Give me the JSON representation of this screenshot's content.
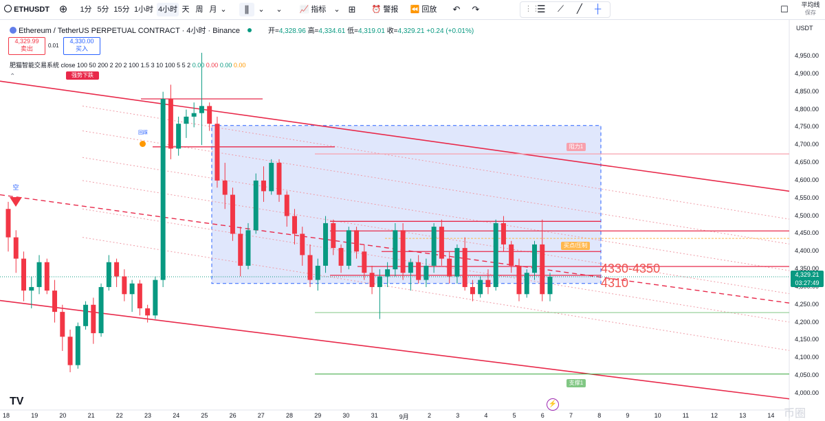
{
  "toolbar": {
    "symbol": "ETHUSDT",
    "intervals": [
      "1分",
      "5分",
      "15分",
      "1小时",
      "4小时",
      "天",
      "周",
      "月"
    ],
    "selected_interval": "4小时",
    "indicators_label": "指标",
    "alert_label": "警报",
    "replay_label": "回放",
    "right_label": "平均线",
    "right_sub": "保存"
  },
  "legend": {
    "title": "Ethereum / TetherUS PERPETUAL CONTRACT · 4小时 · Binance",
    "open_label": "开=",
    "open": "4,328.96",
    "high_label": "高=",
    "high": "4,334.61",
    "low_label": "低=",
    "low": "4,319.01",
    "close_label": "收=",
    "close": "4,329.21",
    "change": "+0.24 (+0.01%)"
  },
  "order": {
    "sell_price": "4,329.99",
    "sell_label": "卖出",
    "spread": "0.01",
    "buy_price": "4,330.00",
    "buy_label": "买入"
  },
  "indicator": {
    "name": "肥猫智能交易系统",
    "params": "close 100 50 200 2 20 2 100 1.5 3 10 100 5 5 2",
    "v1": "0.00",
    "v2": "0.00",
    "v3": "0.00",
    "v4": "0.00"
  },
  "currency": "USDT",
  "price_axis": [
    "4,950.00",
    "4,900.00",
    "4,850.00",
    "4,800.00",
    "4,750.00",
    "4,700.00",
    "4,650.00",
    "4,600.00",
    "4,550.00",
    "4,500.00",
    "4,450.00",
    "4,400.00",
    "4,350.00",
    "4,300.00",
    "4,250.00",
    "4,200.00",
    "4,150.00",
    "4,100.00",
    "4,050.00",
    "4,000.00"
  ],
  "time_axis": [
    "18",
    "19",
    "20",
    "21",
    "22",
    "23",
    "24",
    "25",
    "26",
    "27",
    "28",
    "29",
    "30",
    "31",
    "9月",
    "2",
    "3",
    "4",
    "5",
    "6",
    "7",
    "8",
    "9",
    "10",
    "11",
    "12",
    "13",
    "14"
  ],
  "current_price": {
    "price": "4,329.21",
    "countdown": "03:27:49"
  },
  "annotations": {
    "zone_label": "4330-4350",
    "support_label": "4310",
    "downtrend_tag": "强势下跌",
    "resistance_tag": "阻力1",
    "buy_tag": "买点/压制",
    "support_tag": "支撑1",
    "short_tag": "空",
    "return_tag": "回踩"
  },
  "watermark": "币圈",
  "colors": {
    "up": "#089981",
    "down": "#f23645",
    "channel": "#e8294a",
    "zone": "#c5d3f7",
    "accent": "#2962ff"
  },
  "chart_data": {
    "type": "candlestick",
    "ylim": [
      3980,
      4980
    ],
    "candles": [
      [
        4520,
        4540,
        4400,
        4440
      ],
      [
        4440,
        4460,
        4340,
        4380
      ],
      [
        4380,
        4400,
        4260,
        4290
      ],
      [
        4290,
        4330,
        4240,
        4300
      ],
      [
        4300,
        4390,
        4280,
        4370
      ],
      [
        4370,
        4380,
        4280,
        4290
      ],
      [
        4290,
        4320,
        4200,
        4230
      ],
      [
        4230,
        4250,
        4120,
        4160
      ],
      [
        4160,
        4180,
        4060,
        4080
      ],
      [
        4080,
        4200,
        4070,
        4190
      ],
      [
        4190,
        4260,
        4180,
        4250
      ],
      [
        4250,
        4270,
        4140,
        4170
      ],
      [
        4170,
        4310,
        4160,
        4300
      ],
      [
        4300,
        4390,
        4290,
        4370
      ],
      [
        4370,
        4380,
        4300,
        4330
      ],
      [
        4330,
        4350,
        4260,
        4280
      ],
      [
        4280,
        4320,
        4230,
        4310
      ],
      [
        4310,
        4320,
        4220,
        4240
      ],
      [
        4240,
        4250,
        4200,
        4220
      ],
      [
        4220,
        4330,
        4210,
        4320
      ],
      [
        4320,
        4850,
        4300,
        4830
      ],
      [
        4830,
        4870,
        4660,
        4690
      ],
      [
        4690,
        4780,
        4670,
        4760
      ],
      [
        4760,
        4800,
        4720,
        4780
      ],
      [
        4780,
        4820,
        4750,
        4790
      ],
      [
        4790,
        4960,
        4700,
        4810
      ],
      [
        4810,
        4820,
        4740,
        4760
      ],
      [
        4760,
        4780,
        4580,
        4600
      ],
      [
        4600,
        4650,
        4520,
        4560
      ],
      [
        4560,
        4580,
        4430,
        4450
      ],
      [
        4450,
        4470,
        4330,
        4360
      ],
      [
        4360,
        4480,
        4350,
        4460
      ],
      [
        4460,
        4620,
        4450,
        4600
      ],
      [
        4600,
        4640,
        4540,
        4570
      ],
      [
        4570,
        4660,
        4560,
        4650
      ],
      [
        4650,
        4660,
        4540,
        4560
      ],
      [
        4560,
        4570,
        4470,
        4500
      ],
      [
        4500,
        4520,
        4420,
        4450
      ],
      [
        4450,
        4470,
        4360,
        4390
      ],
      [
        4390,
        4420,
        4300,
        4320
      ],
      [
        4320,
        4380,
        4290,
        4360
      ],
      [
        4360,
        4500,
        4340,
        4480
      ],
      [
        4480,
        4490,
        4390,
        4410
      ],
      [
        4410,
        4420,
        4340,
        4360
      ],
      [
        4360,
        4470,
        4350,
        4460
      ],
      [
        4460,
        4470,
        4380,
        4400
      ],
      [
        4400,
        4420,
        4320,
        4340
      ],
      [
        4340,
        4360,
        4280,
        4300
      ],
      [
        4300,
        4350,
        4210,
        4330
      ],
      [
        4330,
        4370,
        4300,
        4350
      ],
      [
        4350,
        4480,
        4330,
        4460
      ],
      [
        4460,
        4480,
        4320,
        4340
      ],
      [
        4340,
        4380,
        4290,
        4370
      ],
      [
        4370,
        4390,
        4310,
        4320
      ],
      [
        4320,
        4380,
        4300,
        4360
      ],
      [
        4360,
        4480,
        4340,
        4470
      ],
      [
        4470,
        4490,
        4360,
        4380
      ],
      [
        4380,
        4400,
        4310,
        4330
      ],
      [
        4330,
        4420,
        4310,
        4410
      ],
      [
        4410,
        4440,
        4290,
        4300
      ],
      [
        4300,
        4320,
        4260,
        4280
      ],
      [
        4280,
        4330,
        4270,
        4320
      ],
      [
        4320,
        4350,
        4280,
        4300
      ],
      [
        4300,
        4490,
        4290,
        4480
      ],
      [
        4480,
        4500,
        4400,
        4420
      ],
      [
        4420,
        4430,
        4340,
        4360
      ],
      [
        4360,
        4380,
        4260,
        4280
      ],
      [
        4280,
        4350,
        4270,
        4340
      ],
      [
        4340,
        4430,
        4320,
        4420
      ],
      [
        4420,
        4490,
        4260,
        4280
      ],
      [
        4280,
        4340,
        4260,
        4329
      ]
    ]
  }
}
